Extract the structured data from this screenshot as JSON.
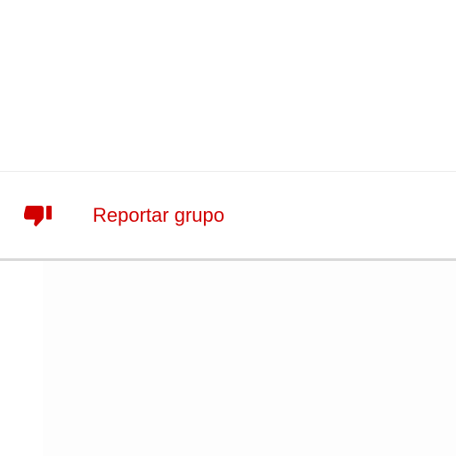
{
  "menu": {
    "report_group": {
      "icon": "thumbs-down-icon",
      "label": "Reportar grupo",
      "color": "#d10000"
    }
  }
}
